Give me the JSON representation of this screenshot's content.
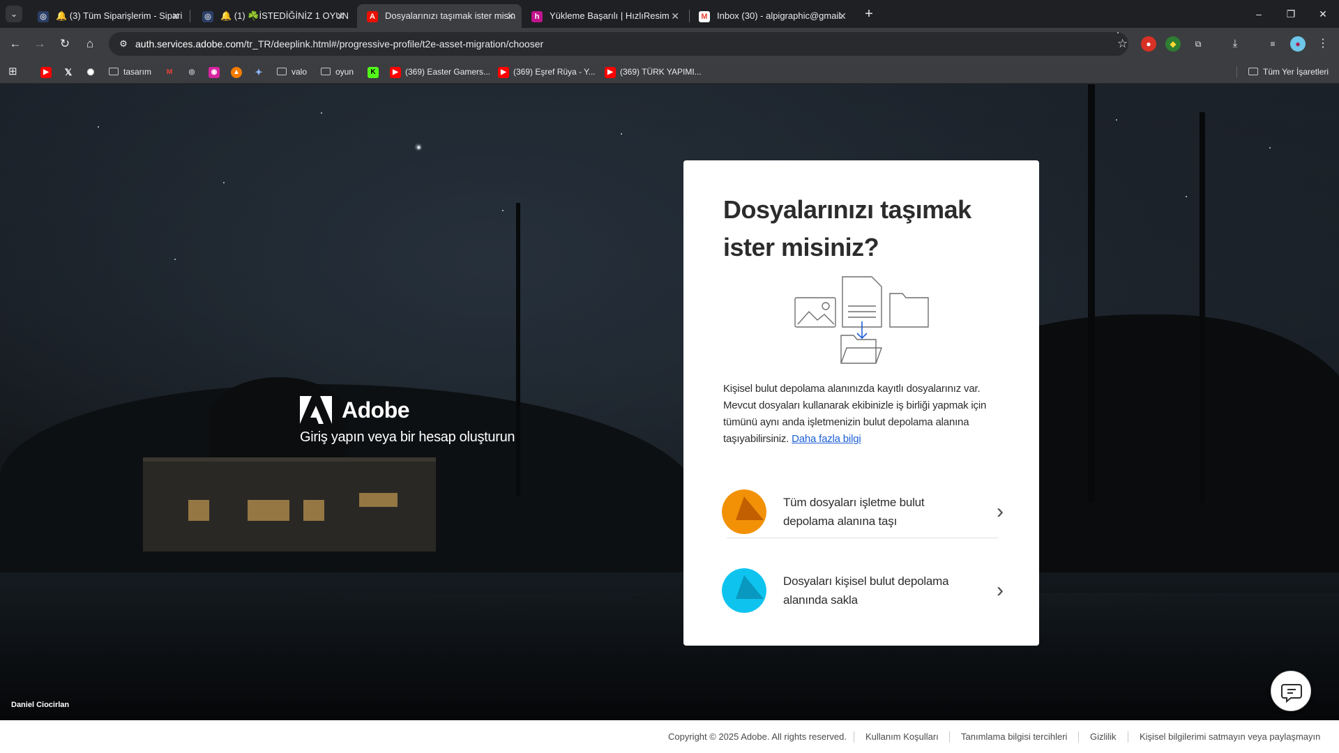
{
  "browser": {
    "tab_list_icon": "chevron-down-icon",
    "tabs": [
      {
        "title": "🔔 (3) Tüm Siparişlerim - Sipari",
        "favicon": "swirl-icon",
        "active": false
      },
      {
        "title": "🔔 (1) ☘️İSTEDİĞİNİZ 1 OYUN",
        "favicon": "swirl-icon",
        "active": false
      },
      {
        "title": "Dosyalarınızı taşımak ister misin",
        "favicon": "adobe-icon",
        "active": true
      },
      {
        "title": "Yükleme Başarılı | HızlıResim",
        "favicon": "hizliresim-icon",
        "active": false
      },
      {
        "title": "Inbox (30) - alpigraphic@gmail.",
        "favicon": "gmail-icon",
        "active": false
      }
    ],
    "new_tab_label": "+",
    "window_controls": {
      "minimize": "–",
      "restore": "❐",
      "close": "✕"
    },
    "url": {
      "host": "auth.services.adobe.com",
      "path": "/tr_TR/deeplink.html#/progressive-profile/t2e-asset-migration/chooser"
    },
    "bookmarks": [
      {
        "label": "",
        "icon": "youtube-icon"
      },
      {
        "label": "",
        "icon": "x-icon"
      },
      {
        "label": "",
        "icon": "openai-icon"
      },
      {
        "label": "tasarım",
        "icon": "folder-icon"
      },
      {
        "label": "",
        "icon": "gmail-icon"
      },
      {
        "label": "",
        "icon": "swirl-icon"
      },
      {
        "label": "",
        "icon": "instagram-icon"
      },
      {
        "label": "",
        "icon": "orange-app-icon"
      },
      {
        "label": "",
        "icon": "gemini-icon"
      },
      {
        "label": "valo",
        "icon": "folder-icon"
      },
      {
        "label": "oyun",
        "icon": "folder-icon"
      },
      {
        "label": "",
        "icon": "kick-icon"
      },
      {
        "label": "(369) Easter Gamers...",
        "icon": "youtube-icon"
      },
      {
        "label": "(369) Eşref Rüya - Y...",
        "icon": "youtube-icon"
      },
      {
        "label": "(369) TÜRK YAPIMI...",
        "icon": "youtube-icon"
      }
    ],
    "all_bookmarks_label": "Tüm Yer İşaretleri"
  },
  "hero": {
    "brand_name": "Adobe",
    "tagline": "Giriş yapın veya bir hesap oluşturun",
    "photo_credit": "Daniel Ciocirlan"
  },
  "card": {
    "title": "Dosyalarınızı taşımak ister misiniz?",
    "description": "Kişisel bulut depolama alanınızda kayıtlı dosyalarınız var. Mevcut dosyaları kullanarak ekibinizle iş birliği yapmak için tümünü aynı anda işletmenizin bulut depolama alanına taşıyabilirsiniz.",
    "learn_more": "Daha fazla bilgi",
    "options": [
      {
        "label": "Tüm dosyaları işletme bulut depolama alanına taşı",
        "color": "#f29106"
      },
      {
        "label": "Dosyaları kişisel bulut depolama alanında sakla",
        "color": "#0ec4ef"
      }
    ]
  },
  "footer": {
    "copyright": "Copyright © 2025 Adobe. All rights reserved.",
    "links": [
      "Kullanım Koşulları",
      "Tanımlama bilgisi tercihleri",
      "Gizlilik",
      "Kişisel bilgilerimi satmayın veya paylaşmayın"
    ]
  }
}
